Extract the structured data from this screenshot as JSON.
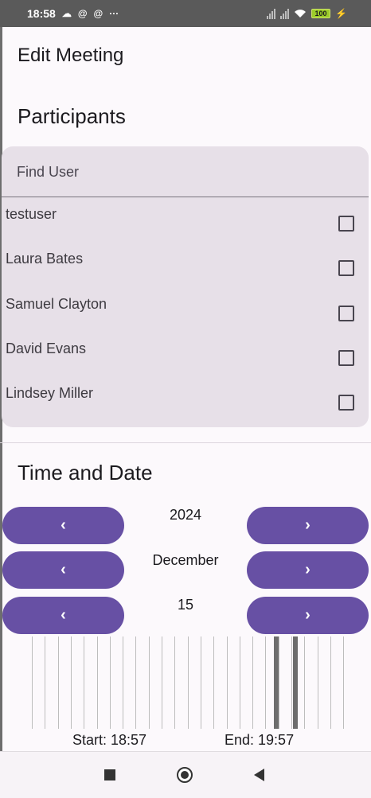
{
  "status_bar": {
    "time": "18:58",
    "battery": "100",
    "left_icons": [
      "cloud-icon",
      "at-sign-icon",
      "at-sign-icon",
      "more-icon"
    ],
    "right_icons": [
      "signal-icon",
      "signal-icon",
      "wifi-icon",
      "battery-icon",
      "charging-icon"
    ]
  },
  "page": {
    "title": "Edit Meeting"
  },
  "participants": {
    "heading": "Participants",
    "search_placeholder": "Find User",
    "users": [
      {
        "name": "testuser",
        "checked": false
      },
      {
        "name": "Laura Bates",
        "checked": false
      },
      {
        "name": "Samuel Clayton",
        "checked": false
      },
      {
        "name": "David Evans",
        "checked": false
      },
      {
        "name": "Lindsey Miller",
        "checked": false
      }
    ]
  },
  "time_and_date": {
    "heading": "Time and Date",
    "year": "2024",
    "month": "December",
    "day": "15",
    "prev_label": "‹",
    "next_label": "›",
    "start_label": "Start: 18:57",
    "end_label": "End: 19:57"
  },
  "colors": {
    "accent": "#6750a4",
    "panel": "#e7e0e8",
    "background": "#fcf9fc"
  }
}
